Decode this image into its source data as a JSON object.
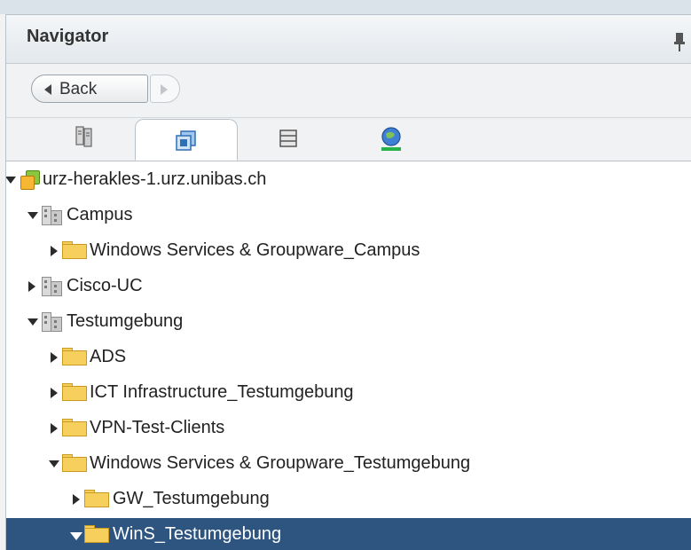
{
  "navigator": {
    "title": "Navigator",
    "back_label": "Back"
  },
  "tabs": [
    {
      "name": "hosts-clusters",
      "icon": "hosts-clusters-icon",
      "active": false
    },
    {
      "name": "vms-templates",
      "icon": "vms-templates-icon",
      "active": true
    },
    {
      "name": "storage",
      "icon": "storage-icon",
      "active": false
    },
    {
      "name": "networking",
      "icon": "networking-icon",
      "active": false
    }
  ],
  "tree": [
    {
      "label": "urz-herakles-1.urz.unibas.ch",
      "icon": "vcenter-icon",
      "expanded": true,
      "selected": false
    },
    {
      "label": "Campus",
      "icon": "datacenter-icon",
      "expanded": true,
      "selected": false
    },
    {
      "label": "Windows Services & Groupware_Campus",
      "icon": "folder-icon",
      "expanded": false,
      "selected": false
    },
    {
      "label": "Cisco-UC",
      "icon": "datacenter-icon",
      "expanded": false,
      "selected": false
    },
    {
      "label": "Testumgebung",
      "icon": "datacenter-icon",
      "expanded": true,
      "selected": false
    },
    {
      "label": "ADS",
      "icon": "folder-icon",
      "expanded": false,
      "selected": false
    },
    {
      "label": "ICT Infrastructure_Testumgebung",
      "icon": "folder-icon",
      "expanded": false,
      "selected": false
    },
    {
      "label": "VPN-Test-Clients",
      "icon": "folder-icon",
      "expanded": false,
      "selected": false
    },
    {
      "label": "Windows Services & Groupware_Testumgebung",
      "icon": "folder-icon",
      "expanded": true,
      "selected": false
    },
    {
      "label": "GW_Testumgebung",
      "icon": "folder-icon",
      "expanded": false,
      "selected": false
    },
    {
      "label": "WinS_Testumgebung",
      "icon": "folder-icon",
      "expanded": true,
      "selected": true
    }
  ],
  "colors": {
    "selection": "#2e5580",
    "folder": "#f6cf5c"
  }
}
